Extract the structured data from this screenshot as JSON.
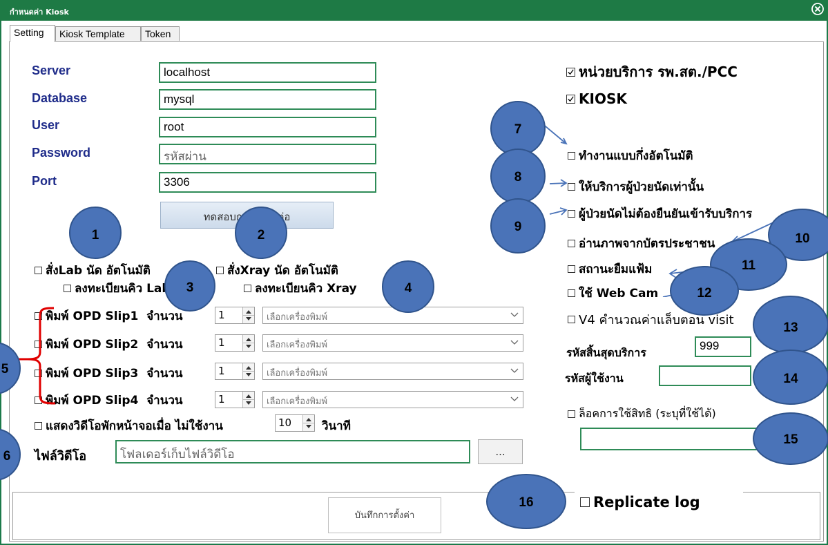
{
  "window": {
    "title": "กำหนดค่า Kiosk",
    "close_icon": "close-circle-icon"
  },
  "tabs": [
    {
      "label": "Setting"
    },
    {
      "label": "Kiosk Template"
    },
    {
      "label": "Token"
    }
  ],
  "db": {
    "server_label": "Server",
    "server_value": "localhost",
    "database_label": "Database",
    "database_value": "mysql",
    "user_label": "User",
    "user_value": "root",
    "password_label": "Password",
    "password_placeholder": "รหัสผ่าน",
    "port_label": "Port",
    "port_value": "3306",
    "test_button": "ทดสอบการเชื่อมต่อ"
  },
  "left_options": {
    "lab_auto": "สั่งLab นัด อัตโนมัติ",
    "lab_register": "ลงทะเบียนคิว Lab",
    "xray_auto": "สั่งXray นัด อัตโนมัติ",
    "xray_register": "ลงทะเบียนคิว Xray"
  },
  "slips": [
    {
      "label": "พิมพ์ OPD Slip1",
      "qty_label": "จำนวน",
      "qty": "1",
      "printer": "เลือกเครื่องพิมพ์"
    },
    {
      "label": "พิมพ์ OPD Slip2",
      "qty_label": "จำนวน",
      "qty": "1",
      "printer": "เลือกเครื่องพิมพ์"
    },
    {
      "label": "พิมพ์ OPD Slip3",
      "qty_label": "จำนวน",
      "qty": "1",
      "printer": "เลือกเครื่องพิมพ์"
    },
    {
      "label": "พิมพ์ OPD Slip4",
      "qty_label": "จำนวน",
      "qty": "1",
      "printer": "เลือกเครื่องพิมพ์"
    }
  ],
  "video": {
    "idle_label": "แสดงวิดีโอพักหน้าจอเมื่อ ไม่ใช้งาน",
    "idle_value": "10",
    "idle_unit": "วินาที",
    "file_label": "ไฟล์วิดีโอ",
    "folder_placeholder": "โฟลเดอร์เก็บไฟล์วิดีโอ",
    "browse_label": "..."
  },
  "right_options": {
    "pcc": "หน่วยบริการ รพ.สต./PCC",
    "kiosk": "KIOSK",
    "semi_auto": "ทำงานแบบกึ่งอัตโนมัติ",
    "appointment_only": "ให้บริการผู้ป่วยนัดเท่านั้น",
    "no_confirm": "ผู้ป่วยนัดไม่ต้องยืนยันเข้ารับบริการ",
    "read_card": "อ่านภาพจากบัตรประชาชน",
    "borrow_file": "สถานะยืมแฟ้ม",
    "webcam": "ใช้ Web Cam",
    "v4_calc": "V4 คำนวณค่าแล็บตอน visit",
    "end_code_label": "รหัสสิ้นสุดบริการ",
    "end_code_value": "999",
    "user_code_label": "รหัสผู้ใช้งาน",
    "user_code_value": "",
    "lock_label": "ล็อคการใช้สิทธิ (ระบุที่ใช้ได้)",
    "lock_value": "",
    "replicate": "Replicate log"
  },
  "save_button": "บันทึกการตั้งค่า",
  "callouts": [
    "1",
    "2",
    "3",
    "4",
    "5",
    "6",
    "7",
    "8",
    "9",
    "10",
    "11",
    "12",
    "13",
    "14",
    "15",
    "16"
  ],
  "colors": {
    "titlebar": "#1e7a45",
    "label_blue": "#1f2c8a",
    "callout_fill": "#4a73b8",
    "arrow": "#4a73b8",
    "bracket": "#e00000"
  }
}
